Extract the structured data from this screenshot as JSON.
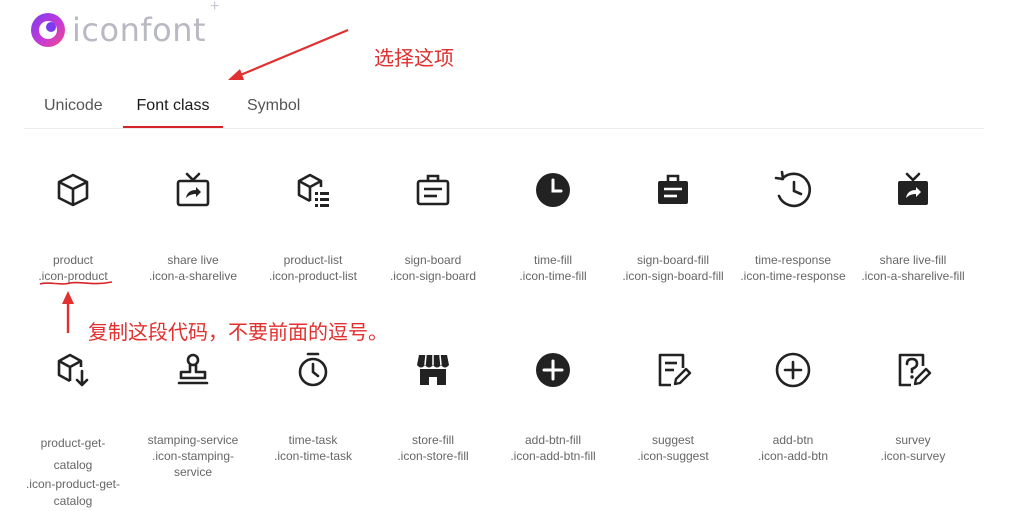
{
  "logo": {
    "text": "iconfont",
    "plus": "+"
  },
  "tabs": [
    {
      "label": "Unicode",
      "active": false
    },
    {
      "label": "Font class",
      "active": true
    },
    {
      "label": "Symbol",
      "active": false
    }
  ],
  "annotations": {
    "select_tab": "选择这项",
    "copy_hint": "复制这段代码，不要前面的逗号。",
    "color": "#e0302f"
  },
  "icons": [
    {
      "name": "product",
      "class": ".icon-product",
      "icon": "cube-outline-icon"
    },
    {
      "name": "share live",
      "class": ".icon-a-sharelive",
      "icon": "tv-share-outline-icon"
    },
    {
      "name": "product-list",
      "class": ".icon-product-list",
      "icon": "cube-list-icon"
    },
    {
      "name": "sign-board",
      "class": ".icon-sign-board",
      "icon": "sign-board-outline-icon"
    },
    {
      "name": "time-fill",
      "class": ".icon-time-fill",
      "icon": "clock-fill-icon"
    },
    {
      "name": "sign-board-fill",
      "class": ".icon-sign-board-fill",
      "icon": "sign-board-fill-icon"
    },
    {
      "name": "time-response",
      "class": ".icon-time-response",
      "icon": "clock-history-icon"
    },
    {
      "name": "share live-fill",
      "class": ".icon-a-sharelive-fill",
      "icon": "tv-share-fill-icon"
    },
    {
      "name": "product-get-catalog",
      "class": ".icon-product-get-catalog",
      "icon": "cube-download-icon"
    },
    {
      "name": "stamping-service",
      "class": ".icon-stamping-service",
      "icon": "stamp-icon"
    },
    {
      "name": "time-task",
      "class": ".icon-time-task",
      "icon": "stopwatch-icon"
    },
    {
      "name": "store-fill",
      "class": ".icon-store-fill",
      "icon": "store-fill-icon"
    },
    {
      "name": "add-btn-fill",
      "class": ".icon-add-btn-fill",
      "icon": "plus-circle-fill-icon"
    },
    {
      "name": "suggest",
      "class": ".icon-suggest",
      "icon": "note-edit-icon"
    },
    {
      "name": "add-btn",
      "class": ".icon-add-btn",
      "icon": "plus-circle-outline-icon"
    },
    {
      "name": "survey",
      "class": ".icon-survey",
      "icon": "question-edit-icon"
    }
  ]
}
